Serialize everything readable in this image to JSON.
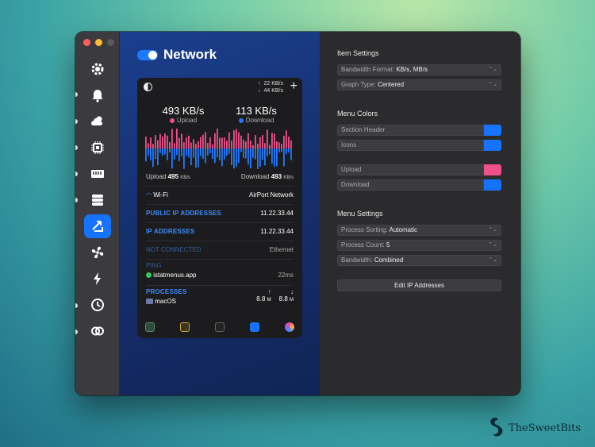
{
  "title": "Network",
  "menubar": {
    "upload_rate": "22 KB/s",
    "download_rate": "44 KB/s",
    "up_arrow": "↑",
    "down_arrow": "↓",
    "plus": "+"
  },
  "panel": {
    "upload_value": "493 KB/s",
    "upload_label": "Upload",
    "download_value": "113 KB/s",
    "download_label": "Download",
    "total_upload_label": "Upload",
    "total_upload_value": "495",
    "total_upload_unit": "KB/s",
    "total_download_label": "Download",
    "total_download_value": "493",
    "total_download_unit": "KB/s",
    "wifi_label": "Wi-Fi",
    "wifi_value": "AirPort Network",
    "public_ip_label": "PUBLIC IP ADDRESSES",
    "public_ip_value": "11.22.33.44",
    "ip_label": "IP ADDRESSES",
    "ip_value": "11.22.33.44",
    "not_connected_label": "NOT CONNECTED",
    "not_connected_value": "Ethernet",
    "ping_label": "PING",
    "ping_host": "istatmenus.app",
    "ping_value": "22ms",
    "processes_label": "PROCESSES",
    "process_name": "macOS",
    "process_up": "8.8",
    "process_down": "8.8",
    "process_unit": "M",
    "up_arrow": "↑",
    "down_arrow": "↓"
  },
  "settings": {
    "item_settings_header": "Item Settings",
    "bandwidth_format_label": "Bandwidth Format:",
    "bandwidth_format_value": "KB/s, MB/s",
    "graph_type_label": "Graph Type:",
    "graph_type_value": "Centered",
    "menu_colors_header": "Menu Colors",
    "section_header_label": "Section Header",
    "icons_label": "Icons",
    "upload_label": "Upload",
    "download_label": "Download",
    "menu_settings_header": "Menu Settings",
    "process_sorting_label": "Process Sorting:",
    "process_sorting_value": "Automatic",
    "process_count_label": "Process Count:",
    "process_count_value": "5",
    "bandwidth_label": "Bandwidth:",
    "bandwidth_value": "Combined",
    "edit_ip_button": "Edit IP Addresses",
    "chevron": "⌃⌄"
  },
  "colors": {
    "accent_blue": "#1673ff",
    "upload_pink": "#f0508a",
    "download_blue": "#1f7aff"
  },
  "brand": {
    "name": "TheSweetBits"
  }
}
